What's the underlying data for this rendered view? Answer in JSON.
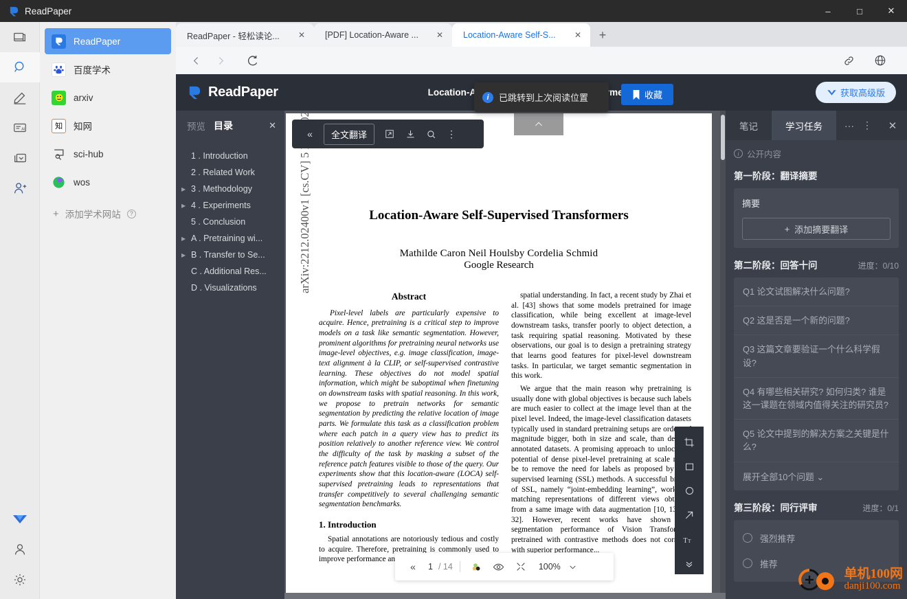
{
  "window": {
    "app_title": "ReadPaper",
    "minimize": "–",
    "maximize": "□",
    "close": "✕"
  },
  "rail": {
    "items": [
      {
        "name": "library-icon",
        "glyph": "▤"
      },
      {
        "name": "search-icon",
        "glyph": "⌕"
      },
      {
        "name": "annotate-icon",
        "glyph": "✎"
      },
      {
        "name": "ai-translate-icon",
        "glyph": "AI"
      },
      {
        "name": "collection-icon",
        "glyph": "❏"
      },
      {
        "name": "add-user-icon",
        "glyph": "👤"
      }
    ],
    "bottom": [
      {
        "name": "vip-icon",
        "glyph": "V"
      },
      {
        "name": "account-icon",
        "glyph": "○"
      },
      {
        "name": "settings-icon",
        "glyph": "⚙"
      }
    ]
  },
  "sites": {
    "items": [
      {
        "label": "ReadPaper",
        "icon": "readpaper-icon",
        "active": true
      },
      {
        "label": "百度学术",
        "icon": "baidu-xueshu-icon",
        "active": false
      },
      {
        "label": "arxiv",
        "icon": "arxiv-icon",
        "active": false
      },
      {
        "label": "知网",
        "icon": "cnki-icon",
        "active": false
      },
      {
        "label": "sci-hub",
        "icon": "scihub-icon",
        "active": false
      },
      {
        "label": "wos",
        "icon": "wos-icon",
        "active": false
      }
    ],
    "add_label": "添加学术网站",
    "add_plus": "+",
    "help_glyph": "?"
  },
  "tabs": {
    "items": [
      {
        "label": "ReadPaper - 轻松读论...",
        "active": false
      },
      {
        "label": "[PDF] Location-Aware ...",
        "active": false
      },
      {
        "label": "Location-Aware Self-S...",
        "active": true
      }
    ],
    "close_glyph": "✕",
    "new_tab_glyph": "+"
  },
  "navbar": {
    "back": "‹",
    "forward": "›",
    "reload": "↻",
    "link_icon": "link-icon",
    "globe_icon": "globe-icon"
  },
  "rp_header": {
    "logo_text": "ReadPaper",
    "doc_title": "Location-Aware Self-Supervised Transformers",
    "favorite_label": "收藏",
    "favorite_icon": "bookmark-icon",
    "vip_label": "获取高级版",
    "vip_icon": "vip-v-icon"
  },
  "toast": {
    "message": "已跳转到上次阅读位置",
    "icon": "info-icon",
    "icon_glyph": "i"
  },
  "toc": {
    "tab_preview": "预览",
    "tab_outline": "目录",
    "close_glyph": "✕",
    "items": [
      {
        "label": "1 . Introduction",
        "expandable": false
      },
      {
        "label": "2 . Related Work",
        "expandable": false
      },
      {
        "label": "3 . Methodology",
        "expandable": true
      },
      {
        "label": "4 . Experiments",
        "expandable": true
      },
      {
        "label": "5 . Conclusion",
        "expandable": false
      },
      {
        "label": "A . Pretraining wi...",
        "expandable": true
      },
      {
        "label": "B . Transfer to Se...",
        "expandable": true
      },
      {
        "label": "C . Additional Res...",
        "expandable": false
      },
      {
        "label": "D . Visualizations",
        "expandable": false
      }
    ]
  },
  "pdf_toolbar": {
    "collapse_glyph": "«",
    "translate_label": "全文翻译",
    "expand_icon": "external-link-icon",
    "download_icon": "download-icon",
    "search_icon": "search-icon",
    "more_icon": "more-vertical-icon",
    "scroll_up_glyph": "⌃"
  },
  "pdf_bottom": {
    "prev_glyph": "«",
    "page_current": "1",
    "page_total": "/ 14",
    "color_icon": "highlight-color-icon",
    "eye_icon": "eye-icon",
    "fit_icon": "fit-screen-icon",
    "zoom_value": "100%",
    "zoom_caret": "⌄"
  },
  "annot_toolbar": {
    "items": [
      {
        "name": "crop-icon",
        "glyph": "⌗"
      },
      {
        "name": "rectangle-icon",
        "glyph": "□"
      },
      {
        "name": "ellipse-icon",
        "glyph": "○"
      },
      {
        "name": "arrow-icon",
        "glyph": "↗"
      },
      {
        "name": "text-icon",
        "glyph": "Tт"
      },
      {
        "name": "more-down-icon",
        "glyph": "⌄"
      }
    ]
  },
  "paper": {
    "arxiv_stamp": "arXiv:2212.02400v1  [cs.CV]  5 Dec 2022",
    "title": "Location-Aware Self-Supervised Transformers",
    "authors": "Mathilde Caron      Neil Houlsby      Cordelia Schmid",
    "affiliation": "Google Research",
    "abstract_heading": "Abstract",
    "abstract_body": "Pixel-level labels are particularly expensive to acquire. Hence, pretraining is a critical step to improve models on a task like semantic segmentation. However, prominent algorithms for pretraining neural networks use image-level objectives, e.g. image classification, image-text alignment à la CLIP, or self-supervised contrastive learning. These objectives do not model spatial information, which might be suboptimal when finetuning on downstream tasks with spatial reasoning. In this work, we propose to pretrain networks for semantic segmentation by predicting the relative location of image parts. We formulate this task as a classification problem where each patch in a query view has to predict its position relatively to another reference view. We control the difficulty of the task by masking a subset of the reference patch features visible to those of the query. Our experiments show that this location-aware (LOCA) self-supervised pretraining leads to representations that transfer competitively to several challenging semantic segmentation benchmarks.",
    "section1_heading": "1. Introduction",
    "section1_body": "Spatial annotations are notoriously tedious and costly to acquire. Therefore, pretraining is commonly used to improve performance and label efficiency of models rea...",
    "right_col_p1": "spatial understanding. In fact, a recent study by Zhai et al. [43] shows that some models pretrained for image classification, while being excellent at image-level downstream tasks, transfer poorly to object detection, a task requiring spatial reasoning. Motivated by these observations, our goal is to design a pretraining strategy that learns good features for pixel-level downstream tasks. In particular, we target semantic segmentation in this work.",
    "right_col_p2": "We argue that the main reason why pretraining is usually done with global objectives is because such labels are much easier to collect at the image level than at the pixel level. Indeed, the image-level classification datasets typically used in standard pretraining setups are orders of magnitude bigger, both in size and scale, than densely annotated datasets. A promising approach to unlock the potential of dense pixel-level pretraining at scale might be to remove the need for labels as proposed by self-supervised learning (SSL) methods. A successful branch of SSL, namely “joint-embedding learning”, works by matching representations of different views obtained from a same image with data augmentation [10, 13, 29, 32]. However, recent works have shown that segmentation performance of Vision Transformers pretrained with contrastive methods does not correlate with superior performance..."
  },
  "study_panel": {
    "tab_notes": "笔记",
    "tab_tasks": "学习任务",
    "more_glyph": "···",
    "menu_glyph": "⋮",
    "close_glyph": "✕",
    "public_label": "公开内容",
    "stage1_title": "第一阶段：翻译摘要",
    "abstract_card_title": "摘要",
    "add_translation_label": "添加摘要翻译",
    "add_plus": "+",
    "stage2_title": "第二阶段：回答十问",
    "stage2_progress": "进度：0/10",
    "questions": [
      "Q1 论文试图解决什么问题?",
      "Q2 这是否是一个新的问题?",
      "Q3 这篇文章要验证一个什么科学假设?",
      "Q4 有哪些相关研究? 如何归类? 谁是这一课题在领域内值得关注的研究员?",
      "Q5 论文中提到的解决方案之关键是什么?"
    ],
    "expand_all_label": "展开全部10个问题",
    "expand_caret": "⌄",
    "stage3_title": "第三阶段：同行评审",
    "stage3_progress": "进度：0/1",
    "review_options": [
      "强烈推荐",
      "推荐"
    ]
  },
  "watermark": {
    "cn": "单机100网",
    "en": "danji100.com"
  },
  "colors": {
    "accent_blue": "#1569d6",
    "tab_active_blue": "#1a73e8",
    "panel_dark": "#3a3f49",
    "header_dark": "#2b2f37",
    "sidebar_active": "#5b9bf0",
    "watermark_orange": "#ef7518"
  }
}
